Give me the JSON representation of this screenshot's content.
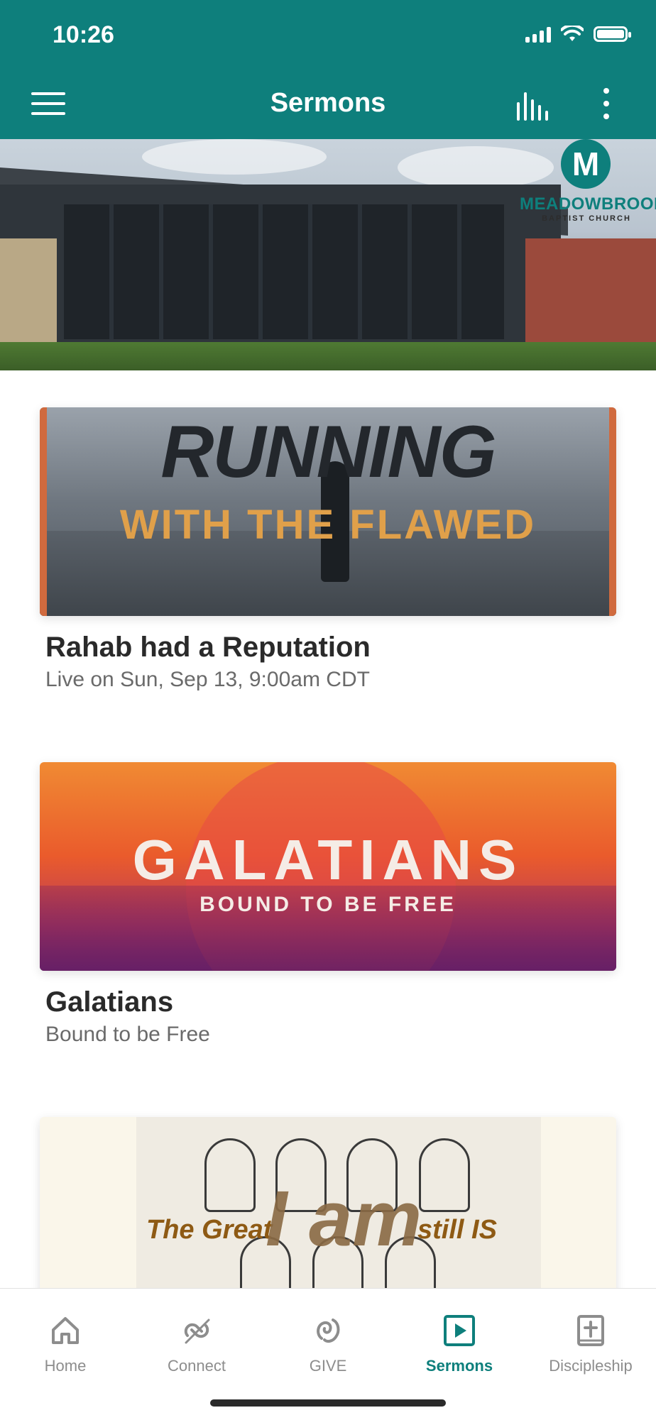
{
  "status_bar": {
    "time": "10:26"
  },
  "app_bar": {
    "title": "Sermons",
    "menu_icon": "hamburger-menu-icon",
    "chart_icon": "audio-bars-icon",
    "more_icon": "more-vertical-icon",
    "background_color": "#0e7f7c"
  },
  "hero": {
    "logo_letter": "M",
    "logo_name": "MEADOWBROOK",
    "logo_subtitle": "BAPTIST CHURCH"
  },
  "cards": [
    {
      "art_title_big": "RUNNING",
      "art_title_small": "WITH THE FLAWED",
      "title": "Rahab had a Reputation",
      "subtitle": "Live on Sun, Sep 13, 9:00am CDT"
    },
    {
      "art_title_big": "GALATIANS",
      "art_title_small": "BOUND TO BE FREE",
      "title": "Galatians",
      "subtitle": "Bound to be Free"
    },
    {
      "art_left": "The Great",
      "art_mid": "I am",
      "art_right": "still IS"
    }
  ],
  "tabbar": {
    "active_color": "#0e7f7c",
    "tabs": [
      {
        "label": "Home",
        "icon": "home-icon"
      },
      {
        "label": "Connect",
        "icon": "connect-icon"
      },
      {
        "label": "GIVE",
        "icon": "give-icon"
      },
      {
        "label": "Sermons",
        "icon": "play-icon"
      },
      {
        "label": "Discipleship",
        "icon": "bible-icon"
      }
    ]
  }
}
